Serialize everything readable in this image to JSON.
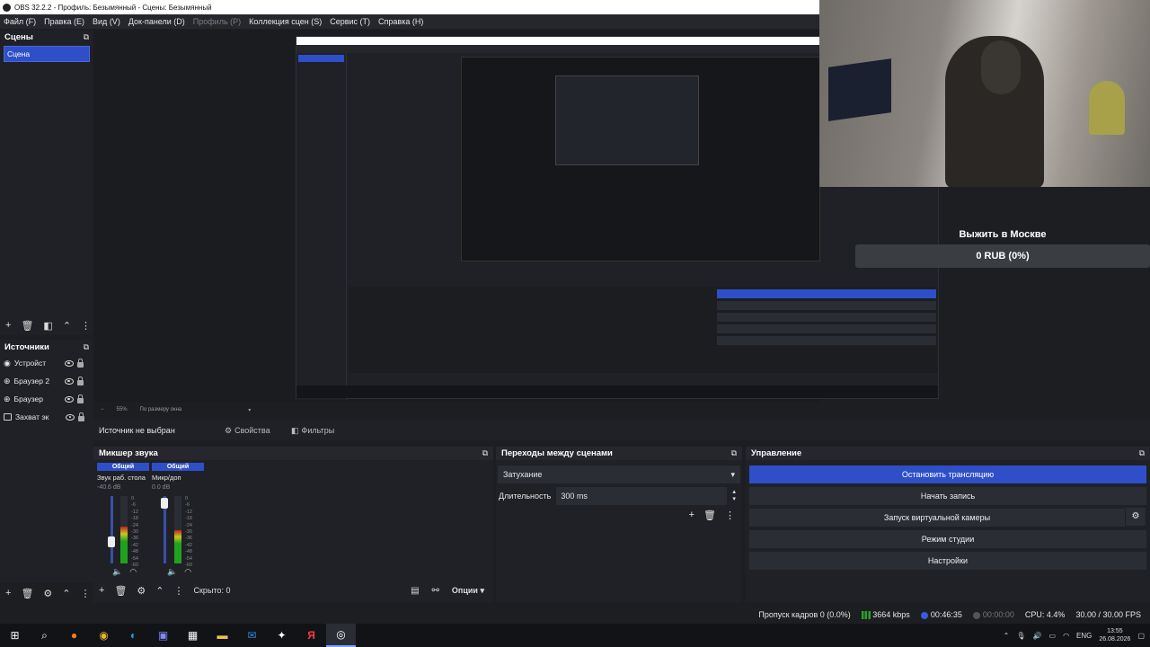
{
  "window": {
    "title": "OBS 32.2.2 - Профиль: Безымянный - Сцены: Безымянный"
  },
  "menu": [
    {
      "label": "Файл (F)",
      "enabled": true
    },
    {
      "label": "Правка (E)",
      "enabled": true
    },
    {
      "label": "Вид (V)",
      "enabled": true
    },
    {
      "label": "Док-панели (D)",
      "enabled": true
    },
    {
      "label": "Профиль (P)",
      "enabled": false
    },
    {
      "label": "Коллекция сцен (S)",
      "enabled": true
    },
    {
      "label": "Сервис (T)",
      "enabled": true
    },
    {
      "label": "Справка (H)",
      "enabled": true
    }
  ],
  "scenes": {
    "title": "Сцены",
    "items": [
      "Сцена"
    ]
  },
  "sources": {
    "title": "Источники",
    "items": [
      "Устройст",
      "Браузер 2",
      "Браузер",
      "Захват эк"
    ]
  },
  "preview": {
    "zoom": "55%",
    "fit": "По размеру окна",
    "donation_title": "Выжить в Москве",
    "donation_amount": "0 RUB (0%)"
  },
  "context": {
    "label": "Источник не выбран",
    "properties": "Свойства",
    "filters": "Фильтры"
  },
  "audio": {
    "title": "Микшер звука",
    "channels": [
      {
        "tag": "Общий",
        "name": "Звук раб. стола",
        "db": "-40.6 dB",
        "level": 0.55
      },
      {
        "tag": "Общий",
        "name": "Микр/доп",
        "db": "0.0 dB",
        "level": 0.5
      }
    ],
    "scale": [
      "0",
      "-6",
      "-12",
      "-18",
      "-24",
      "-30",
      "-36",
      "-42",
      "-48",
      "-54",
      "-60"
    ],
    "cache": "Скрыто: 0",
    "options": "Опции"
  },
  "transitions": {
    "title": "Переходы между сценами",
    "selected": "Затухание",
    "duration_label": "Длительность",
    "duration_value": "300 ms"
  },
  "controls": {
    "title": "Управление",
    "stop_stream": "Остановить трансляцию",
    "start_record": "Начать запись",
    "virtual_cam": "Запуск виртуальной камеры",
    "studio_mode": "Режим студии",
    "settings": "Настройки"
  },
  "status": {
    "dropped": "Пропуск кадров 0 (0.0%)",
    "bitrate": "3664 kbps",
    "stream_time": "00:46:35",
    "record_time": "00:00:00",
    "cpu": "CPU: 4.4%",
    "fps": "30.00 / 30.00 FPS"
  },
  "taskbar": {
    "lang": "ENG",
    "time": "13:55",
    "date": "26.08.2026"
  },
  "colors": {
    "accent": "#2f4fc8",
    "bg": "#1f2126"
  }
}
